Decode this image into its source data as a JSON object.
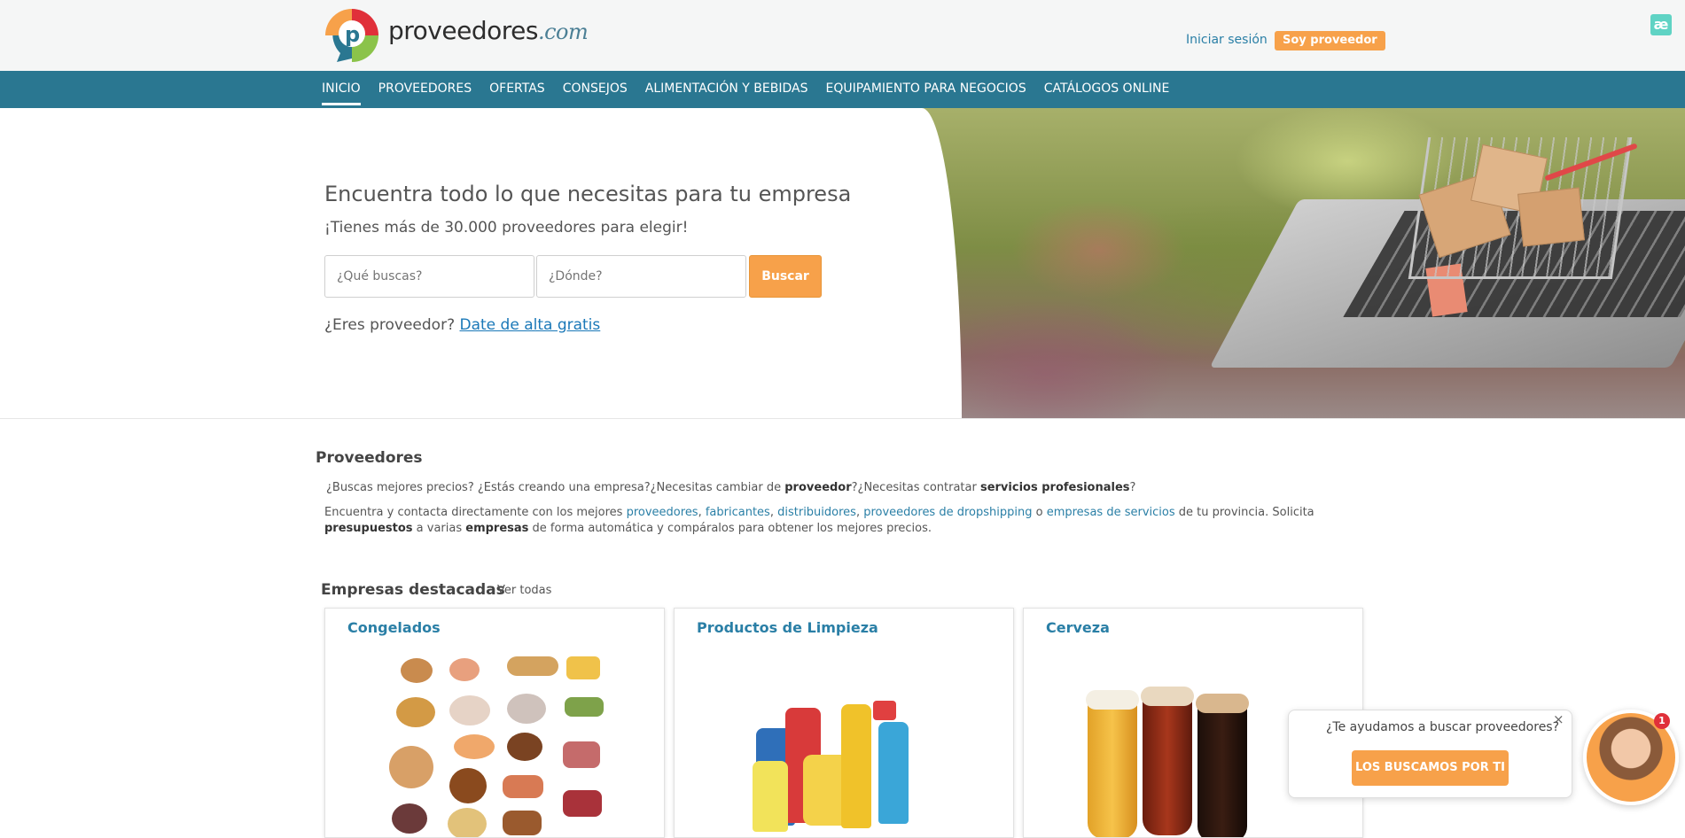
{
  "header": {
    "logo_text": "proveedores",
    "logo_suffix": ".com",
    "login_label": "Iniciar sesión",
    "provider_button": "Soy proveedor",
    "ae_icon": "æ"
  },
  "nav": {
    "items": [
      {
        "label": "INICIO",
        "active": true
      },
      {
        "label": "PROVEEDORES"
      },
      {
        "label": "OFERTAS"
      },
      {
        "label": "CONSEJOS"
      },
      {
        "label": "ALIMENTACIÓN Y BEBIDAS"
      },
      {
        "label": "EQUIPAMIENTO PARA NEGOCIOS"
      },
      {
        "label": "CATÁLOGOS ONLINE"
      }
    ]
  },
  "hero": {
    "title": "Encuentra todo lo que necesitas para tu empresa",
    "subtitle": "¡Tienes más de 30.000 proveedores para elegir!",
    "search_what_placeholder": "¿Qué buscas?",
    "search_where_placeholder": "¿Dónde?",
    "search_button": "Buscar",
    "cta_text": "¿Eres proveedor?",
    "cta_link": "Date de alta gratis"
  },
  "providers": {
    "title": "Proveedores",
    "line1": {
      "a": "¿Buscas mejores precios? ¿Estás creando una empresa?¿Necesitas cambiar de ",
      "b": "proveedor",
      "c": "?¿Necesitas contratar ",
      "d": "servicios profesionales",
      "e": "?"
    },
    "para": {
      "a": "Encuentra y contacta directamente con los mejores ",
      "l1": "proveedores",
      "s1": ", ",
      "l2": "fabricantes",
      "s2": ", ",
      "l3": "distribuidores",
      "s3": ", ",
      "l4": "proveedores de dropshipping",
      "s4": " o ",
      "l5": "empresas de servicios",
      "b": " de tu provincia. Solicita ",
      "b1": "presupuestos",
      "c": " a varias ",
      "b2": "empresas",
      "d": " de forma automática y compáralos para obtener los mejores precios."
    }
  },
  "featured": {
    "title": "Empresas destacadas",
    "see_all": "Ver todas",
    "cards": [
      {
        "title": "Congelados",
        "image_icon": "frozen-food-image"
      },
      {
        "title": "Productos de Limpieza",
        "image_icon": "cleaning-products-image"
      },
      {
        "title": "Cerveza",
        "image_icon": "beer-glasses-image"
      }
    ]
  },
  "chat": {
    "question": "¿Te ayudamos a buscar proveedores?",
    "button": "LOS BUSCAMOS POR TI",
    "close": "×",
    "badge": "1"
  },
  "colors": {
    "navbar": "#2a7791",
    "accent": "#f7a14a",
    "link": "#2a7fa6"
  }
}
